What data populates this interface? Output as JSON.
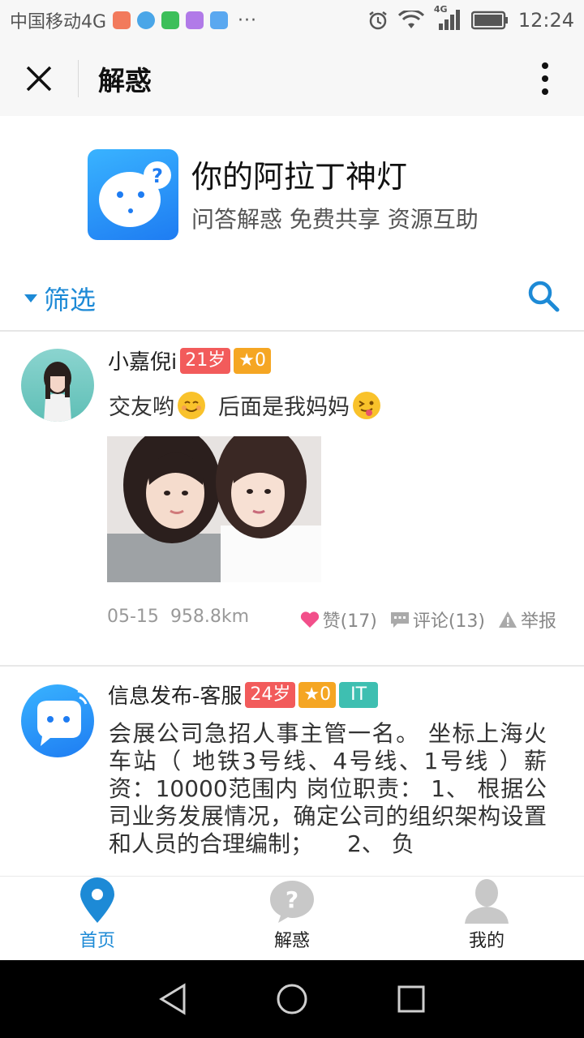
{
  "status_bar": {
    "carrier": "中国移动4G",
    "dots": "···",
    "network": "4G",
    "time": "12:24"
  },
  "nav": {
    "title": "解惑"
  },
  "banner": {
    "title": "你的阿拉丁神灯",
    "subtitle": "问答解惑 免费共享 资源互助"
  },
  "filter": {
    "label": "筛选"
  },
  "posts": [
    {
      "username": "小嘉倪i",
      "age": "21岁",
      "stars": "★0",
      "text_a": "交友哟",
      "text_b": "后面是我妈妈",
      "date": "05-15",
      "distance": "958.8km",
      "like_label": "赞(17)",
      "comment_label": "评论(13)",
      "report_label": "举报"
    },
    {
      "username": "信息发布-客服",
      "age": "24岁",
      "stars": "★0",
      "tag": "IT",
      "text": "会展公司急招人事主管一名。 坐标上海火车站（ 地铁3号线、4号线、1号线 ）薪资：10000范围内 岗位职责： 1、 根据公司业务发展情况，确定公司的组织架构设置和人员的合理编制；　　2、 负"
    }
  ],
  "tabbar": {
    "home": "首页",
    "qa": "解惑",
    "mine": "我的"
  },
  "colors": {
    "accent": "#1d8ad6",
    "age_badge": "#f25b5b",
    "star_badge": "#f5a623",
    "tag_badge": "#3ebfb1"
  }
}
